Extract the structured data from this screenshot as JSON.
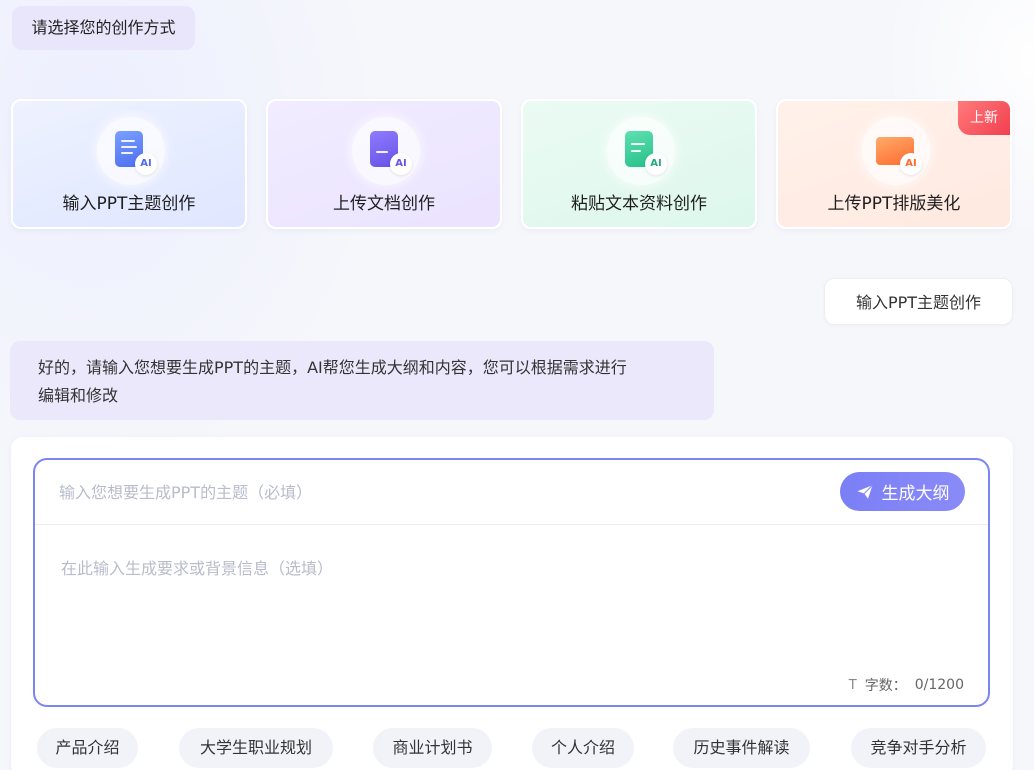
{
  "prompt_title": "请选择您的创作方式",
  "cards": [
    {
      "label": "输入PPT主题创作",
      "ai": "AI"
    },
    {
      "label": "上传文档创作",
      "ai": "AI"
    },
    {
      "label": "粘贴文本资料创作",
      "ai": "AI"
    },
    {
      "label": "上传PPT排版美化",
      "ai": "AI",
      "tag": "上新"
    }
  ],
  "user_message": "输入PPT主题创作",
  "bot_message": {
    "line1": "好的，请输入您想要生成PPT的主题，AI帮您生成大纲和内容，您可以根据需求进行",
    "line2": "编辑和修改"
  },
  "form": {
    "topic_placeholder": "输入您想要生成PPT的主题（必填）",
    "generate_label": "生成大纲",
    "desc_placeholder": "在此输入生成要求或背景信息（选填）",
    "counter_icon": "T",
    "counter_label": "字数：",
    "counter_value": "0/1200"
  },
  "chips": [
    "产品介绍",
    "大学生职业规划",
    "商业计划书",
    "个人介绍",
    "历史事件解读",
    "竞争对手分析"
  ],
  "colors": {
    "accent": "#7b86f3",
    "new_tag": "#f23f4f",
    "bubble_bot": "#ebe8fc"
  }
}
